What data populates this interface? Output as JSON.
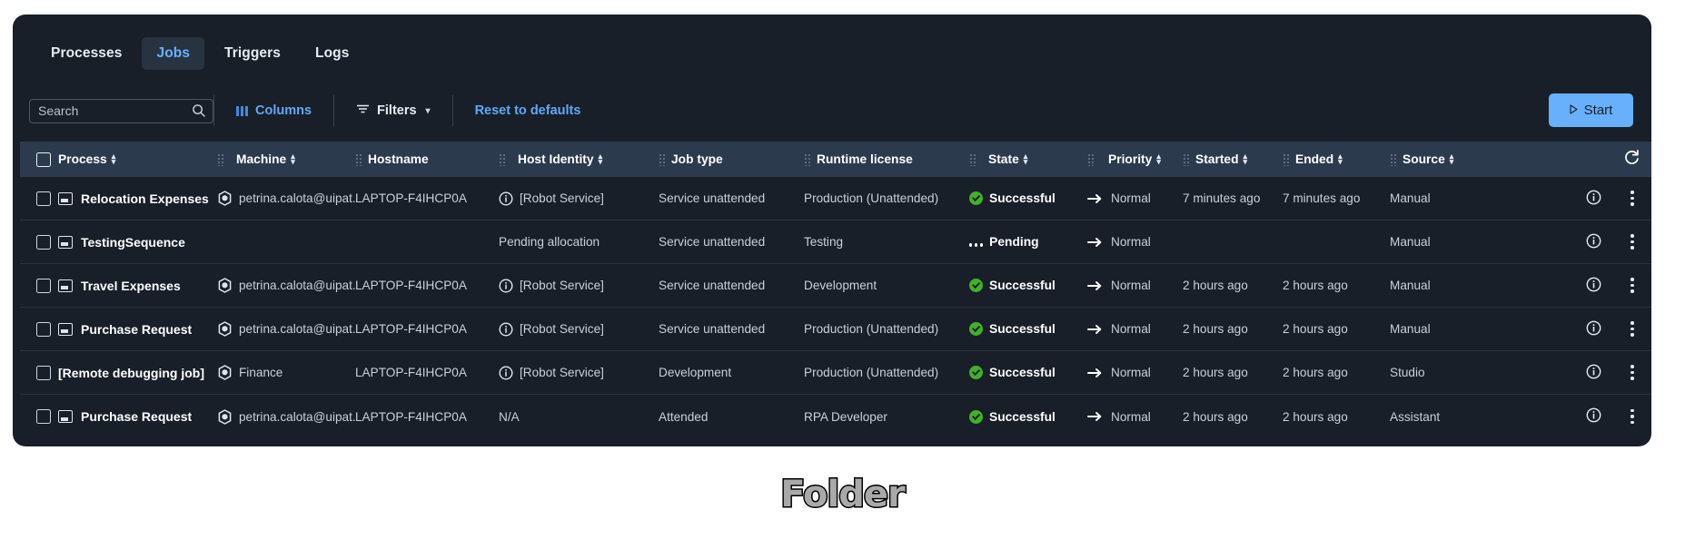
{
  "tabs": [
    {
      "label": "Processes",
      "active": false
    },
    {
      "label": "Jobs",
      "active": true
    },
    {
      "label": "Triggers",
      "active": false
    },
    {
      "label": "Logs",
      "active": false
    }
  ],
  "toolbar": {
    "search_value": "",
    "search_placeholder": "Search",
    "search_icon": "search-icon",
    "columns_label": "Columns",
    "columns_icon": "columns-icon",
    "filters_label": "Filters",
    "filters_icon": "filter-icon",
    "filters_chevron": "chevron-down-icon",
    "reset_label": "Reset to defaults",
    "start_label": "Start",
    "start_icon": "play-icon",
    "accent_blue": "#68b0fb",
    "link_blue": "#62a8f7"
  },
  "table": {
    "refresh_icon": "refresh-icon",
    "columns": [
      {
        "key": "process",
        "label": "Process",
        "sortable": true
      },
      {
        "key": "machine",
        "label": "Machine",
        "sortable": true
      },
      {
        "key": "hostname",
        "label": "Hostname",
        "sortable": false
      },
      {
        "key": "hostid",
        "label": "Host Identity",
        "sortable": true
      },
      {
        "key": "jobtype",
        "label": "Job type",
        "sortable": false
      },
      {
        "key": "runtime",
        "label": "Runtime license",
        "sortable": false
      },
      {
        "key": "state",
        "label": "State",
        "sortable": true
      },
      {
        "key": "priority",
        "label": "Priority",
        "sortable": true
      },
      {
        "key": "started",
        "label": "Started",
        "sortable": true
      },
      {
        "key": "ended",
        "label": "Ended",
        "sortable": true
      },
      {
        "key": "source",
        "label": "Source",
        "sortable": true
      }
    ],
    "rows": [
      {
        "process": "Relocation Expenses",
        "has_process_icon": true,
        "machine": "petrina.calota@uipat...",
        "has_machine_icon": true,
        "hostname": "LAPTOP-F4IHCP0A",
        "hostid": "[Robot Service]",
        "has_hostid_icon": true,
        "jobtype": "Service unattended",
        "runtime": "Production (Unattended)",
        "state": "Successful",
        "state_kind": "success",
        "priority": "Normal",
        "started": "7 minutes ago",
        "ended": "7 minutes ago",
        "source": "Manual"
      },
      {
        "process": "TestingSequence",
        "has_process_icon": true,
        "machine": "",
        "has_machine_icon": false,
        "hostname": "",
        "hostid": "Pending allocation",
        "has_hostid_icon": false,
        "jobtype": "Service unattended",
        "runtime": "Testing",
        "state": "Pending",
        "state_kind": "pending",
        "priority": "Normal",
        "started": "",
        "ended": "",
        "source": "Manual"
      },
      {
        "process": "Travel Expenses",
        "has_process_icon": true,
        "machine": "petrina.calota@uipat...",
        "has_machine_icon": true,
        "hostname": "LAPTOP-F4IHCP0A",
        "hostid": "[Robot Service]",
        "has_hostid_icon": true,
        "jobtype": "Service unattended",
        "runtime": "Development",
        "state": "Successful",
        "state_kind": "success",
        "priority": "Normal",
        "started": "2 hours ago",
        "ended": "2 hours ago",
        "source": "Manual"
      },
      {
        "process": "Purchase Request",
        "has_process_icon": true,
        "machine": "petrina.calota@uipat...",
        "has_machine_icon": true,
        "hostname": "LAPTOP-F4IHCP0A",
        "hostid": "[Robot Service]",
        "has_hostid_icon": true,
        "jobtype": "Service unattended",
        "runtime": "Production (Unattended)",
        "state": "Successful",
        "state_kind": "success",
        "priority": "Normal",
        "started": "2 hours ago",
        "ended": "2 hours ago",
        "source": "Manual"
      },
      {
        "process": "[Remote debugging job]",
        "has_process_icon": false,
        "machine": "Finance",
        "has_machine_icon": true,
        "hostname": "LAPTOP-F4IHCP0A",
        "hostid": "[Robot Service]",
        "has_hostid_icon": true,
        "jobtype": "Development",
        "runtime": "Production (Unattended)",
        "state": "Successful",
        "state_kind": "success",
        "priority": "Normal",
        "started": "2 hours ago",
        "ended": "2 hours ago",
        "source": "Studio"
      },
      {
        "process": "Purchase Request",
        "has_process_icon": true,
        "machine": "petrina.calota@uipat...",
        "has_machine_icon": true,
        "hostname": "LAPTOP-F4IHCP0A",
        "hostid": "N/A",
        "has_hostid_icon": false,
        "jobtype": "Attended",
        "runtime": "RPA Developer",
        "state": "Successful",
        "state_kind": "success",
        "priority": "Normal",
        "started": "2 hours ago",
        "ended": "2 hours ago",
        "source": "Assistant"
      }
    ],
    "row_info_icon": "info-icon",
    "row_menu_icon": "more-vertical-icon",
    "success_color": "#43b02a",
    "header_bg": "#2c3a4d",
    "panel_bg": "#181f28"
  },
  "caption": {
    "text": "Folder"
  }
}
